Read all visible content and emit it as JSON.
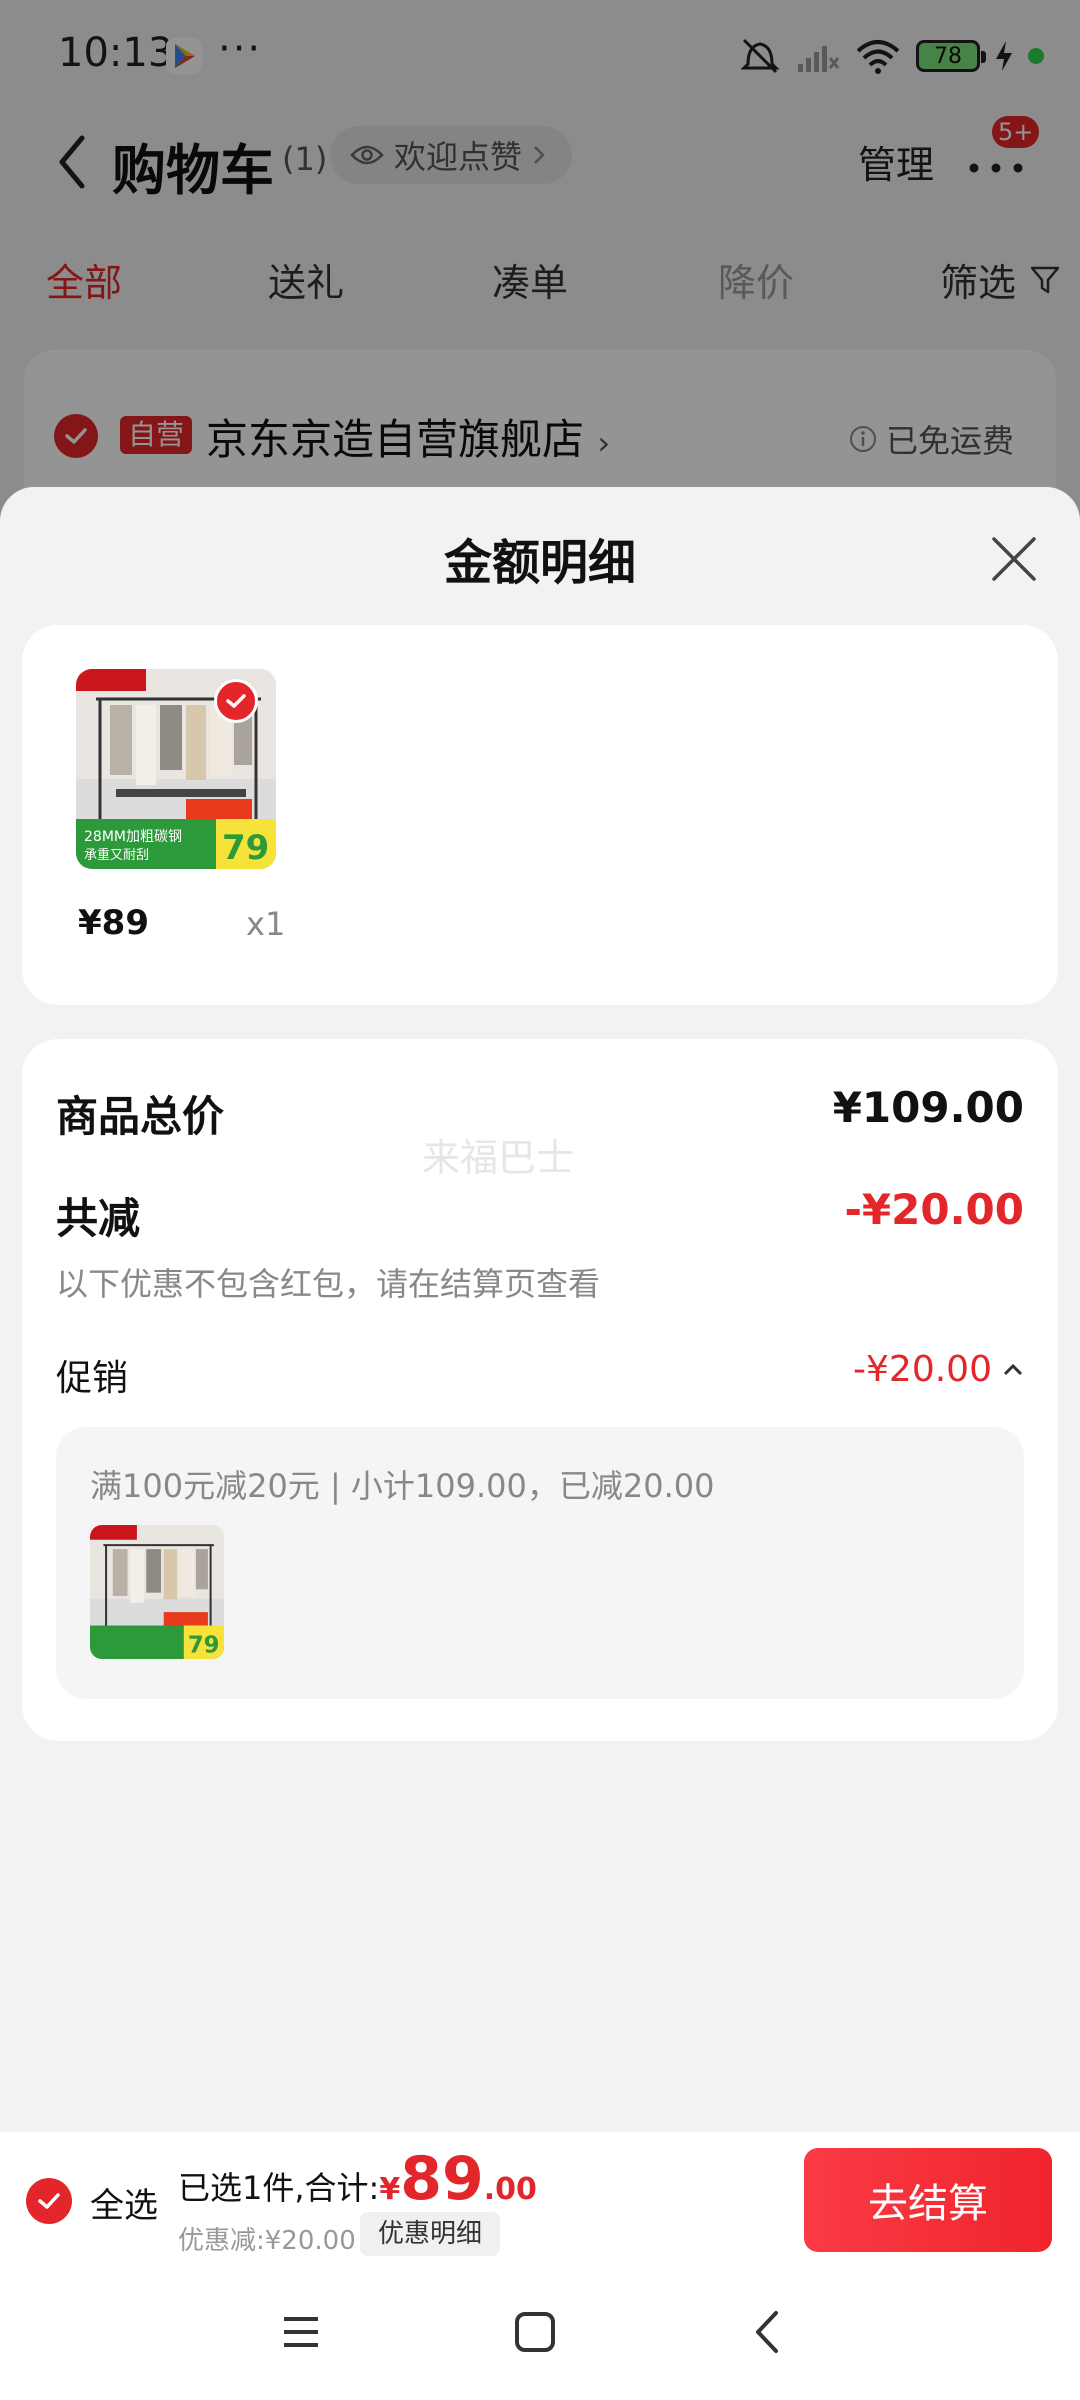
{
  "status_bar": {
    "time": "10:13",
    "dots": "···",
    "battery_level": "78"
  },
  "header": {
    "title": "购物车",
    "count": "(1)",
    "like_label": "欢迎点赞",
    "manage_label": "管理",
    "badge": "5+"
  },
  "tabs": [
    {
      "label": "全部"
    },
    {
      "label": "送礼"
    },
    {
      "label": "凑单"
    },
    {
      "label": "降价"
    }
  ],
  "filter_label": "筛选",
  "store": {
    "tag": "自营",
    "name": "京东京造自营旗舰店",
    "chevron": "›",
    "shipping": "已免运费"
  },
  "sheet": {
    "title": "金额明细",
    "products": [
      {
        "price": "¥89",
        "quantity": "x1"
      }
    ],
    "summary": {
      "total_label": "商品总价",
      "total_value": "¥109.00",
      "watermark": "来福巴士",
      "reduction_label": "共减",
      "reduction_value": "-¥20.00",
      "reduction_note": "以下优惠不包含红包，请在结算页查看",
      "promo_label": "促销",
      "promo_value": "-¥20.00",
      "promo_detail": "满100元减20元 | 小计109.00，已减20.00"
    }
  },
  "checkout": {
    "select_all_label": "全选",
    "selected_prefix": "已选1件,合计:",
    "currency": "¥",
    "total_int": "89",
    "total_dec": ".00",
    "discount_text": "优惠减:¥20.00",
    "discount_detail_button": "优惠明细",
    "checkout_button": "去结算"
  },
  "colors": {
    "accent": "#e3262a",
    "sheet_bg": "#f2f2f2",
    "card_bg": "#ffffff"
  }
}
